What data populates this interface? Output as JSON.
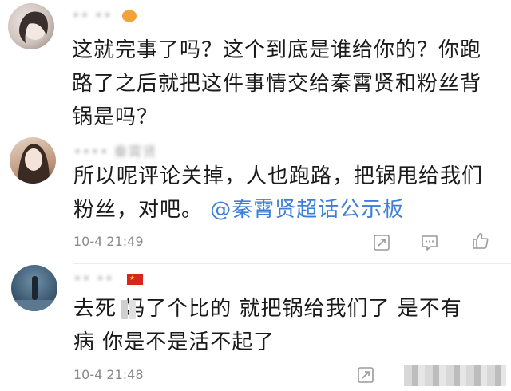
{
  "comments": [
    {
      "username": "•• ••",
      "text": "这就完事了吗？这个到底是谁给你的？你跑路了之后就把这件事情交给秦霄贤和粉丝背锅是吗？",
      "lines": [
        "这就完事了吗？这个到底是谁给你的？你跑",
        "路了之后就把这件事情交给秦霄贤和粉丝背",
        "锅是吗？"
      ]
    },
    {
      "username": "•••• 秦霄贤",
      "lines_plain": [
        "所以呢评论关掉，人也跑路，把锅甩给我们",
        "粉丝，对吧。"
      ],
      "mention": "@秦霄贤超话公示板",
      "timestamp": "10-4 21:49"
    },
    {
      "username": "•• •• ",
      "lines": [
        "去死  妈了个比的  就把锅给我们了  是不有",
        "病  你是不是活不起了"
      ],
      "timestamp": "10-4 21:48"
    }
  ],
  "icons": [
    "share-icon",
    "comment-icon",
    "like-icon"
  ]
}
